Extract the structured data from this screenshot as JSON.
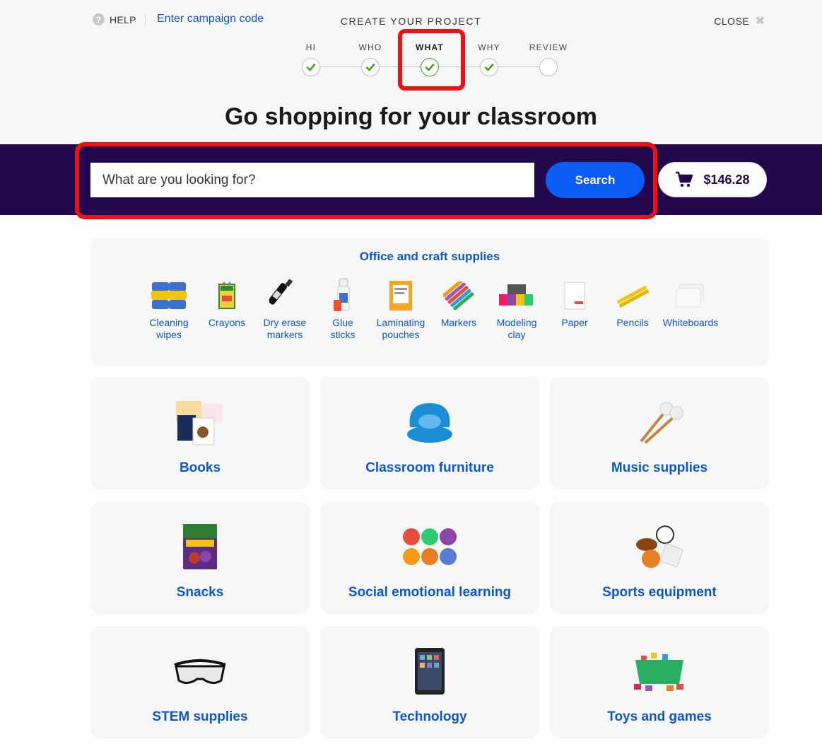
{
  "header": {
    "help_label": "HELP",
    "campaign_link": "Enter campaign code",
    "title": "CREATE YOUR PROJECT",
    "close_label": "CLOSE"
  },
  "stepper": {
    "steps": [
      {
        "label": "HI",
        "state": "done"
      },
      {
        "label": "WHO",
        "state": "done"
      },
      {
        "label": "WHAT",
        "state": "current"
      },
      {
        "label": "WHY",
        "state": "done"
      },
      {
        "label": "REVIEW",
        "state": "empty"
      }
    ]
  },
  "page": {
    "heading": "Go shopping for your classroom"
  },
  "search": {
    "placeholder": "What are you looking for?",
    "button_label": "Search",
    "cart_total": "$146.28"
  },
  "office_supplies": {
    "title": "Office and craft supplies",
    "items": [
      {
        "line1": "Cleaning",
        "line2": "wipes",
        "icon": "cleaning-wipes-icon"
      },
      {
        "line1": "Crayons",
        "line2": "",
        "icon": "crayons-icon"
      },
      {
        "line1": "Dry erase",
        "line2": "markers",
        "icon": "dry-erase-marker-icon"
      },
      {
        "line1": "Glue",
        "line2": "sticks",
        "icon": "glue-stick-icon"
      },
      {
        "line1": "Laminating",
        "line2": "pouches",
        "icon": "laminating-pouches-icon"
      },
      {
        "line1": "Markers",
        "line2": "",
        "icon": "markers-icon"
      },
      {
        "line1": "Modeling",
        "line2": "clay",
        "icon": "modeling-clay-icon"
      },
      {
        "line1": "Paper",
        "line2": "",
        "icon": "paper-icon"
      },
      {
        "line1": "Pencils",
        "line2": "",
        "icon": "pencils-icon"
      },
      {
        "line1": "Whiteboards",
        "line2": "",
        "icon": "whiteboards-icon"
      }
    ]
  },
  "categories": [
    {
      "label": "Books",
      "icon": "books-icon"
    },
    {
      "label": "Classroom furniture",
      "icon": "floor-chair-icon"
    },
    {
      "label": "Music supplies",
      "icon": "mallets-icon"
    },
    {
      "label": "Snacks",
      "icon": "snack-box-icon"
    },
    {
      "label": "Social emotional learning",
      "icon": "emotion-faces-icon"
    },
    {
      "label": "Sports equipment",
      "icon": "sports-balls-icon"
    },
    {
      "label": "STEM supplies",
      "icon": "safety-goggles-icon"
    },
    {
      "label": "Technology",
      "icon": "tablet-icon"
    },
    {
      "label": "Toys and games",
      "icon": "toy-bin-icon"
    }
  ],
  "colors": {
    "accent_blue": "#0b57d0",
    "search_band": "#23084e",
    "search_button": "#0a5cf5",
    "highlight_red": "#ee1111",
    "check_green": "#4a9b1a"
  }
}
